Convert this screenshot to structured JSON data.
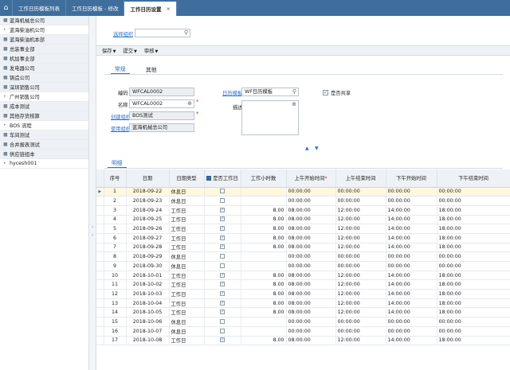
{
  "tabs": [
    {
      "label": "工作日历模板列表"
    },
    {
      "label": "工作日历模板 - 修改"
    },
    {
      "label": "工作日历设置",
      "active": true
    }
  ],
  "sidebar": {
    "items": [
      {
        "label": "蓝海机械总公司",
        "bullet": "■",
        "grey": true
      },
      {
        "label": "蓝海柴油机公司",
        "bullet": "•",
        "grey": false
      },
      {
        "label": "蓝海柴油机本部",
        "bullet": "■",
        "grey": true
      },
      {
        "label": "总装事业部",
        "bullet": "■",
        "grey": true
      },
      {
        "label": "机加事业部",
        "bullet": "■",
        "grey": true
      },
      {
        "label": "发电器公司",
        "bullet": "■",
        "grey": true
      },
      {
        "label": "铸造公司",
        "bullet": "■",
        "grey": true
      },
      {
        "label": "深圳销售公司",
        "bullet": "■",
        "grey": true
      },
      {
        "label": "广州销售公司",
        "bullet": "•",
        "grey": false
      },
      {
        "label": "成本测试",
        "bullet": "■",
        "grey": true
      },
      {
        "label": "其他存货核算",
        "bullet": "■",
        "grey": true
      },
      {
        "label": "BOS 流程",
        "bullet": "•",
        "grey": false
      },
      {
        "label": "车间测试",
        "bullet": "■",
        "grey": true
      },
      {
        "label": "合并报表测试",
        "bullet": "■",
        "grey": true
      },
      {
        "label": "供应链组本",
        "bullet": "■",
        "grey": true
      },
      {
        "label": "hycesh001",
        "bullet": "•",
        "grey": false
      }
    ]
  },
  "filter": {
    "label": "选择组织",
    "value": ""
  },
  "toolbar": {
    "save": "保存",
    "submit": "提交",
    "audit": "审核"
  },
  "subtabs": {
    "general": "常规",
    "other": "其他",
    "detail": "明细"
  },
  "form": {
    "code_label": "编码",
    "code_value": "WFCAL0002",
    "name_label": "名称",
    "name_value": "WFCAL0002",
    "org_label": "创建组织",
    "org_value": "BOS测试",
    "use_org_label": "使用组织",
    "use_org_value": "蓝海机械总公司",
    "template_label": "日历模板",
    "template_value": "WF日历模板",
    "desc_label": "描述",
    "shared_label": "是否共享",
    "shared_checked": "✓"
  },
  "table": {
    "headers": {
      "seq": "序号",
      "date": "日期",
      "daytype": "日期类型",
      "is_workday": "是否工作日",
      "hours": "工作小时数",
      "am_start": "上午开始时间",
      "am_end": "上午结束时间",
      "pm_start": "下午开始时间",
      "pm_end": "下午结束时间"
    },
    "rows": [
      {
        "seq": "1",
        "date": "2018-09-22",
        "daytype": "休息日",
        "chk": "",
        "hours": "",
        "am_start": "00:00:00",
        "am_end": "00:00:00",
        "pm_start": "00:00:00",
        "pm_end": "00:00:00"
      },
      {
        "seq": "2",
        "date": "2018-09-23",
        "daytype": "休息日",
        "chk": "",
        "hours": "",
        "am_start": "00:00:00",
        "am_end": "00:00:00",
        "pm_start": "00:00:00",
        "pm_end": "00:00:00"
      },
      {
        "seq": "3",
        "date": "2018-09-24",
        "daytype": "工作日",
        "chk": "✓",
        "hours": "8.00",
        "am_start": "08:00:00",
        "am_end": "12:00:00",
        "pm_start": "14:00:00",
        "pm_end": "18:00:00"
      },
      {
        "seq": "4",
        "date": "2018-09-25",
        "daytype": "工作日",
        "chk": "✓",
        "hours": "8.00",
        "am_start": "08:00:00",
        "am_end": "12:00:00",
        "pm_start": "14:00:00",
        "pm_end": "18:00:00"
      },
      {
        "seq": "5",
        "date": "2018-09-26",
        "daytype": "工作日",
        "chk": "✓",
        "hours": "8.00",
        "am_start": "08:00:00",
        "am_end": "12:00:00",
        "pm_start": "14:00:00",
        "pm_end": "18:00:00"
      },
      {
        "seq": "6",
        "date": "2018-09-27",
        "daytype": "工作日",
        "chk": "✓",
        "hours": "8.00",
        "am_start": "08:00:00",
        "am_end": "12:00:00",
        "pm_start": "14:00:00",
        "pm_end": "18:00:00"
      },
      {
        "seq": "7",
        "date": "2018-09-28",
        "daytype": "工作日",
        "chk": "✓",
        "hours": "8.00",
        "am_start": "08:00:00",
        "am_end": "12:00:00",
        "pm_start": "14:00:00",
        "pm_end": "18:00:00"
      },
      {
        "seq": "8",
        "date": "2018-09-29",
        "daytype": "休息日",
        "chk": "",
        "hours": "",
        "am_start": "00:00:00",
        "am_end": "00:00:00",
        "pm_start": "00:00:00",
        "pm_end": "00:00:00"
      },
      {
        "seq": "9",
        "date": "2018-09-30",
        "daytype": "休息日",
        "chk": "",
        "hours": "",
        "am_start": "00:00:00",
        "am_end": "00:00:00",
        "pm_start": "00:00:00",
        "pm_end": "00:00:00"
      },
      {
        "seq": "10",
        "date": "2018-10-01",
        "daytype": "工作日",
        "chk": "✓",
        "hours": "8.00",
        "am_start": "08:00:00",
        "am_end": "12:00:00",
        "pm_start": "14:00:00",
        "pm_end": "18:00:00"
      },
      {
        "seq": "11",
        "date": "2018-10-02",
        "daytype": "工作日",
        "chk": "✓",
        "hours": "8.00",
        "am_start": "08:00:00",
        "am_end": "12:00:00",
        "pm_start": "14:00:00",
        "pm_end": "18:00:00"
      },
      {
        "seq": "12",
        "date": "2018-10-03",
        "daytype": "工作日",
        "chk": "✓",
        "hours": "8.00",
        "am_start": "08:00:00",
        "am_end": "12:00:00",
        "pm_start": "14:00:00",
        "pm_end": "18:00:00"
      },
      {
        "seq": "13",
        "date": "2018-10-04",
        "daytype": "工作日",
        "chk": "✓",
        "hours": "8.00",
        "am_start": "08:00:00",
        "am_end": "12:00:00",
        "pm_start": "14:00:00",
        "pm_end": "18:00:00"
      },
      {
        "seq": "14",
        "date": "2018-10-05",
        "daytype": "工作日",
        "chk": "✓",
        "hours": "8.00",
        "am_start": "08:00:00",
        "am_end": "12:00:00",
        "pm_start": "14:00:00",
        "pm_end": "18:00:00"
      },
      {
        "seq": "15",
        "date": "2018-10-06",
        "daytype": "休息日",
        "chk": "",
        "hours": "",
        "am_start": "00:00:00",
        "am_end": "00:00:00",
        "pm_start": "00:00:00",
        "pm_end": "00:00:00"
      },
      {
        "seq": "16",
        "date": "2018-10-07",
        "daytype": "休息日",
        "chk": "",
        "hours": "",
        "am_start": "00:00:00",
        "am_end": "00:00:00",
        "pm_start": "00:00:00",
        "pm_end": "00:00:00"
      },
      {
        "seq": "17",
        "date": "2018-10-08",
        "daytype": "工作日",
        "chk": "✓",
        "hours": "8.00",
        "am_start": "08:00:00",
        "am_end": "12:00:00",
        "pm_start": "14:00:00",
        "pm_end": "18:00:00"
      }
    ]
  },
  "colors": {
    "accent": "#2d72c9",
    "header": "#3f6e9c",
    "selected_row": "#fdf8df"
  }
}
